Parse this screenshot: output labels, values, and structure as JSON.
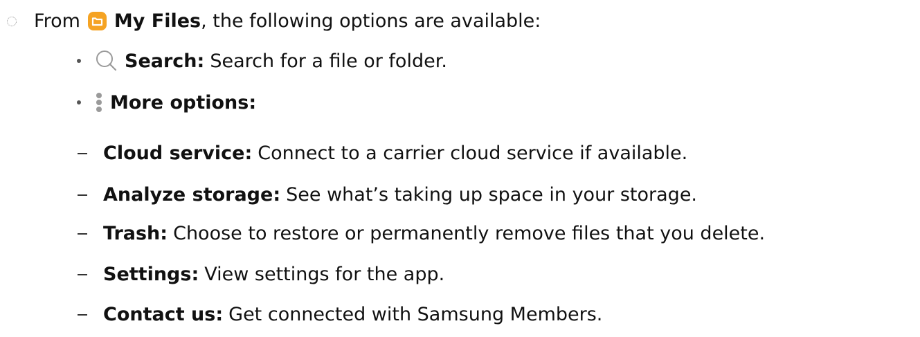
{
  "intro": {
    "prefix": "From",
    "app_name": "My Files",
    "suffix": ", the following options are available:",
    "app_icon": "folder-icon"
  },
  "options": [
    {
      "icon": "search-icon",
      "label": "Search",
      "description": "Search for a file or folder."
    },
    {
      "icon": "more-options-icon",
      "label": "More options",
      "description": ""
    }
  ],
  "more_options": [
    {
      "label": "Cloud service",
      "description": "Connect to a carrier cloud service if available."
    },
    {
      "label": "Analyze storage",
      "description": "See what’s taking up space in your storage."
    },
    {
      "label": "Trash",
      "description": "Choose to restore or permanently remove files that you delete."
    },
    {
      "label": "Settings",
      "description": "View settings for the app."
    },
    {
      "label": "Contact us",
      "description": "Get connected with Samsung Members."
    }
  ],
  "punctuation": {
    "colon": ":"
  },
  "colors": {
    "folder_icon": "#f5a323",
    "search_icon": "#9a9a9a",
    "more_icon": "#9a9a9a",
    "text": "#111111"
  }
}
